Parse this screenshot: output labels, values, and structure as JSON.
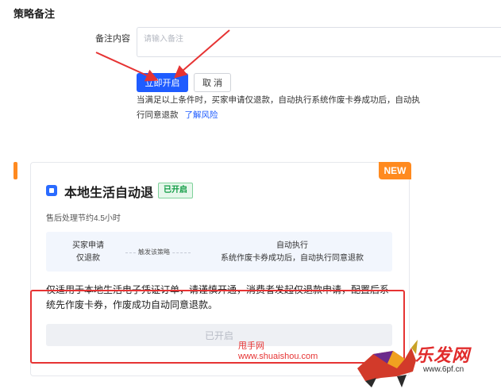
{
  "top": {
    "section_title": "策略备注",
    "field_label": "备注内容",
    "input_value": "",
    "input_placeholder": "请输入备注",
    "primary_button": "立即开启",
    "cancel_button": "取 消",
    "help_line1": "当满足以上条件时，买家申请仅退款，自动执行系统作废卡券成功后，自动执",
    "help_line2": "行同意退款",
    "help_link": "了解风险"
  },
  "card": {
    "badge_new": "NEW",
    "title": "本地生活自动退",
    "status": "已开启",
    "subtitle": "售后处理节约4.5小时",
    "flow": {
      "step1_line1": "买家申请",
      "step1_line2": "仅退款",
      "trigger": "触发该策略",
      "step2_line1": "自动执行",
      "step2_line2": "系统作废卡券成功后，自动执行同意退款"
    },
    "description": "仅适用于本地生活电子凭证订单，请谨慎开通，消费者发起仅退款申请，配置后系统先作废卡券，作废成功自动同意退款。",
    "enabled_button": "已开启"
  },
  "watermarks": {
    "site_cn": "甩手网",
    "site_url": "www.shuaishou.com",
    "logo_text": "乐发网",
    "logo_url": "www.6pf.cn"
  },
  "colors": {
    "primary": "#1f5cff",
    "new_badge": "#ff8a1f",
    "status_green": "#0f9b43",
    "annotation_red": "#e63333"
  }
}
